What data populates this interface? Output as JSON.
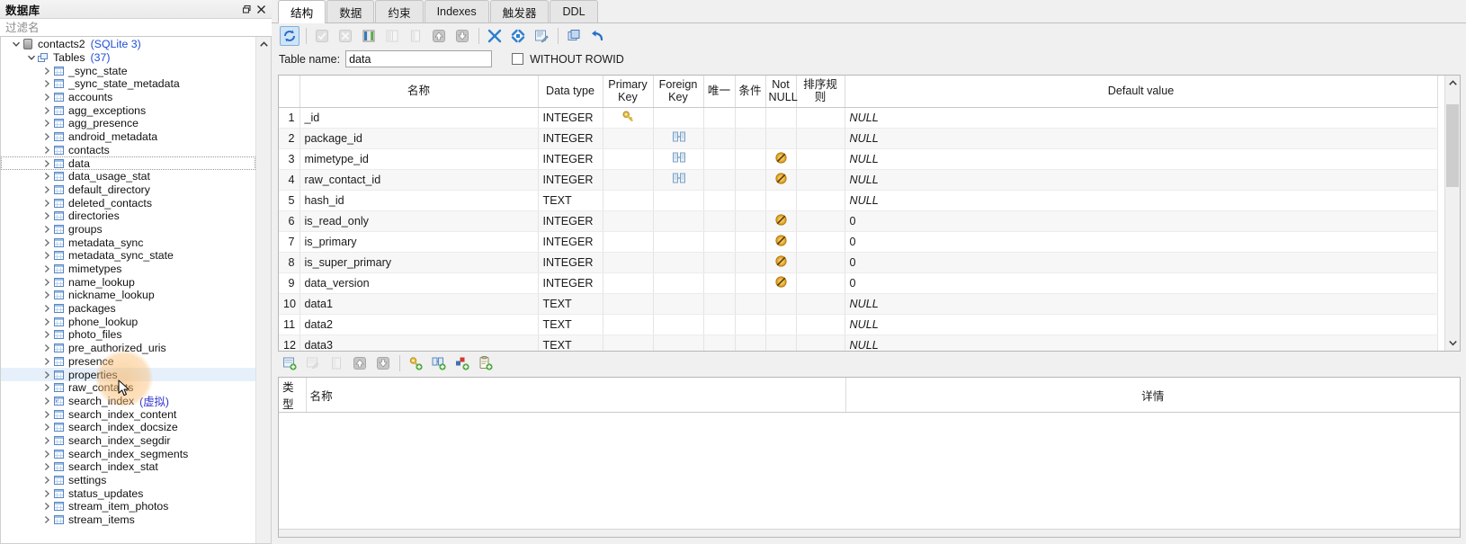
{
  "db_panel": {
    "title": "数据库",
    "float_icon": "restore-icon",
    "close_icon": "close-icon",
    "filter_placeholder": "过滤名",
    "filter_value": "",
    "tree": [
      {
        "depth": 0,
        "twisty": "down",
        "icon": "database-icon",
        "label": "contacts2",
        "sub": "(SQLite 3)"
      },
      {
        "depth": 1,
        "twisty": "down",
        "icon": "tables-folder-icon",
        "label": "Tables",
        "sub": "(37)"
      },
      {
        "depth": 2,
        "twisty": "right",
        "icon": "table-icon",
        "label": "_sync_state",
        "sub": ""
      },
      {
        "depth": 2,
        "twisty": "right",
        "icon": "table-icon",
        "label": "_sync_state_metadata",
        "sub": ""
      },
      {
        "depth": 2,
        "twisty": "right",
        "icon": "table-icon",
        "label": "accounts",
        "sub": ""
      },
      {
        "depth": 2,
        "twisty": "right",
        "icon": "table-icon",
        "label": "agg_exceptions",
        "sub": ""
      },
      {
        "depth": 2,
        "twisty": "right",
        "icon": "table-icon",
        "label": "agg_presence",
        "sub": ""
      },
      {
        "depth": 2,
        "twisty": "right",
        "icon": "table-icon",
        "label": "android_metadata",
        "sub": ""
      },
      {
        "depth": 2,
        "twisty": "right",
        "icon": "table-icon",
        "label": "contacts",
        "sub": ""
      },
      {
        "depth": 2,
        "twisty": "right",
        "icon": "table-icon",
        "label": "data",
        "sub": "",
        "state": "focused"
      },
      {
        "depth": 2,
        "twisty": "right",
        "icon": "table-icon",
        "label": "data_usage_stat",
        "sub": ""
      },
      {
        "depth": 2,
        "twisty": "right",
        "icon": "table-icon",
        "label": "default_directory",
        "sub": ""
      },
      {
        "depth": 2,
        "twisty": "right",
        "icon": "table-icon",
        "label": "deleted_contacts",
        "sub": ""
      },
      {
        "depth": 2,
        "twisty": "right",
        "icon": "table-icon",
        "label": "directories",
        "sub": ""
      },
      {
        "depth": 2,
        "twisty": "right",
        "icon": "table-icon",
        "label": "groups",
        "sub": ""
      },
      {
        "depth": 2,
        "twisty": "right",
        "icon": "table-icon",
        "label": "metadata_sync",
        "sub": ""
      },
      {
        "depth": 2,
        "twisty": "right",
        "icon": "table-icon",
        "label": "metadata_sync_state",
        "sub": ""
      },
      {
        "depth": 2,
        "twisty": "right",
        "icon": "table-icon",
        "label": "mimetypes",
        "sub": ""
      },
      {
        "depth": 2,
        "twisty": "right",
        "icon": "table-icon",
        "label": "name_lookup",
        "sub": ""
      },
      {
        "depth": 2,
        "twisty": "right",
        "icon": "table-icon",
        "label": "nickname_lookup",
        "sub": ""
      },
      {
        "depth": 2,
        "twisty": "right",
        "icon": "table-icon",
        "label": "packages",
        "sub": ""
      },
      {
        "depth": 2,
        "twisty": "right",
        "icon": "table-icon",
        "label": "phone_lookup",
        "sub": ""
      },
      {
        "depth": 2,
        "twisty": "right",
        "icon": "table-icon",
        "label": "photo_files",
        "sub": ""
      },
      {
        "depth": 2,
        "twisty": "right",
        "icon": "table-icon",
        "label": "pre_authorized_uris",
        "sub": ""
      },
      {
        "depth": 2,
        "twisty": "right",
        "icon": "table-icon",
        "label": "presence",
        "sub": ""
      },
      {
        "depth": 2,
        "twisty": "right",
        "icon": "table-icon",
        "label": "properties",
        "sub": "",
        "state": "hover"
      },
      {
        "depth": 2,
        "twisty": "right",
        "icon": "table-icon",
        "label": "raw_contacts",
        "sub": ""
      },
      {
        "depth": 2,
        "twisty": "right",
        "icon": "virtual-table-icon",
        "label": "search_index",
        "sub": "(虚拟)"
      },
      {
        "depth": 2,
        "twisty": "right",
        "icon": "table-icon",
        "label": "search_index_content",
        "sub": ""
      },
      {
        "depth": 2,
        "twisty": "right",
        "icon": "table-icon",
        "label": "search_index_docsize",
        "sub": ""
      },
      {
        "depth": 2,
        "twisty": "right",
        "icon": "table-icon",
        "label": "search_index_segdir",
        "sub": ""
      },
      {
        "depth": 2,
        "twisty": "right",
        "icon": "table-icon",
        "label": "search_index_segments",
        "sub": ""
      },
      {
        "depth": 2,
        "twisty": "right",
        "icon": "table-icon",
        "label": "search_index_stat",
        "sub": ""
      },
      {
        "depth": 2,
        "twisty": "right",
        "icon": "table-icon",
        "label": "settings",
        "sub": ""
      },
      {
        "depth": 2,
        "twisty": "right",
        "icon": "table-icon",
        "label": "status_updates",
        "sub": ""
      },
      {
        "depth": 2,
        "twisty": "right",
        "icon": "table-icon",
        "label": "stream_item_photos",
        "sub": ""
      },
      {
        "depth": 2,
        "twisty": "right",
        "icon": "table-icon",
        "label": "stream_items",
        "sub": ""
      }
    ]
  },
  "tabs": [
    {
      "label": "结构",
      "active": true
    },
    {
      "label": "数据",
      "active": false
    },
    {
      "label": "约束",
      "active": false
    },
    {
      "label": "Indexes",
      "active": false
    },
    {
      "label": "触发器",
      "active": false
    },
    {
      "label": "DDL",
      "active": false
    }
  ],
  "toolbar": [
    {
      "name": "refresh-structure-icon",
      "state": "enabled-active"
    },
    {
      "sep": true
    },
    {
      "name": "commit-check-icon",
      "state": "disabled"
    },
    {
      "name": "rollback-cross-icon",
      "state": "disabled"
    },
    {
      "name": "add-column-icon",
      "state": "enabled"
    },
    {
      "name": "insert-column-icon",
      "state": "disabled"
    },
    {
      "name": "delete-column-icon",
      "state": "disabled"
    },
    {
      "name": "move-column-up-icon",
      "state": "enabled"
    },
    {
      "name": "move-column-down-icon",
      "state": "enabled"
    },
    {
      "sep": true
    },
    {
      "name": "collapse-all-icon",
      "state": "enabled"
    },
    {
      "name": "expand-all-icon",
      "state": "enabled"
    },
    {
      "name": "generate-sql-icon",
      "state": "enabled"
    },
    {
      "sep": true
    },
    {
      "name": "copy-table-icon",
      "state": "enabled"
    },
    {
      "name": "undo-icon",
      "state": "enabled"
    }
  ],
  "table_name_row": {
    "label": "Table name:",
    "value": "data",
    "without_rowid_label": "WITHOUT ROWID",
    "without_rowid_checked": false
  },
  "grid": {
    "headers": [
      "",
      "名称",
      "Data type",
      "Primary Key",
      "Foreign Key",
      "唯一",
      "条件",
      "Not NULL",
      "排序规则",
      "Default value"
    ],
    "rows": [
      {
        "n": "1",
        "name": "_id",
        "type": "INTEGER",
        "pk": "key-icon",
        "fk": "",
        "unique": "",
        "check": "",
        "notnull": "",
        "collate": "",
        "default": "NULL",
        "default_italic": true
      },
      {
        "n": "2",
        "name": "package_id",
        "type": "INTEGER",
        "pk": "",
        "fk": "fk-icon",
        "unique": "",
        "check": "",
        "notnull": "",
        "collate": "",
        "default": "NULL",
        "default_italic": true
      },
      {
        "n": "3",
        "name": "mimetype_id",
        "type": "INTEGER",
        "pk": "",
        "fk": "fk-icon",
        "unique": "",
        "check": "",
        "notnull": "notnull-icon",
        "collate": "",
        "default": "NULL",
        "default_italic": true
      },
      {
        "n": "4",
        "name": "raw_contact_id",
        "type": "INTEGER",
        "pk": "",
        "fk": "fk-icon",
        "unique": "",
        "check": "",
        "notnull": "notnull-icon",
        "collate": "",
        "default": "NULL",
        "default_italic": true
      },
      {
        "n": "5",
        "name": "hash_id",
        "type": "TEXT",
        "pk": "",
        "fk": "",
        "unique": "",
        "check": "",
        "notnull": "",
        "collate": "",
        "default": "NULL",
        "default_italic": true
      },
      {
        "n": "6",
        "name": "is_read_only",
        "type": "INTEGER",
        "pk": "",
        "fk": "",
        "unique": "",
        "check": "",
        "notnull": "notnull-icon",
        "collate": "",
        "default": "0",
        "default_italic": false
      },
      {
        "n": "7",
        "name": "is_primary",
        "type": "INTEGER",
        "pk": "",
        "fk": "",
        "unique": "",
        "check": "",
        "notnull": "notnull-icon",
        "collate": "",
        "default": "0",
        "default_italic": false
      },
      {
        "n": "8",
        "name": "is_super_primary",
        "type": "INTEGER",
        "pk": "",
        "fk": "",
        "unique": "",
        "check": "",
        "notnull": "notnull-icon",
        "collate": "",
        "default": "0",
        "default_italic": false
      },
      {
        "n": "9",
        "name": "data_version",
        "type": "INTEGER",
        "pk": "",
        "fk": "",
        "unique": "",
        "check": "",
        "notnull": "notnull-icon",
        "collate": "",
        "default": "0",
        "default_italic": false
      },
      {
        "n": "10",
        "name": "data1",
        "type": "TEXT",
        "pk": "",
        "fk": "",
        "unique": "",
        "check": "",
        "notnull": "",
        "collate": "",
        "default": "NULL",
        "default_italic": true
      },
      {
        "n": "11",
        "name": "data2",
        "type": "TEXT",
        "pk": "",
        "fk": "",
        "unique": "",
        "check": "",
        "notnull": "",
        "collate": "",
        "default": "NULL",
        "default_italic": true
      },
      {
        "n": "12",
        "name": "data3",
        "type": "TEXT",
        "pk": "",
        "fk": "",
        "unique": "",
        "check": "",
        "notnull": "",
        "collate": "",
        "default": "NULL",
        "default_italic": true
      }
    ]
  },
  "toolbar2": [
    {
      "name": "add-constraint-icon",
      "state": "enabled"
    },
    {
      "name": "edit-constraint-icon",
      "state": "disabled"
    },
    {
      "name": "delete-constraint-icon",
      "state": "disabled"
    },
    {
      "name": "move-constraint-up-icon",
      "state": "enabled"
    },
    {
      "name": "move-constraint-down-icon",
      "state": "enabled"
    },
    {
      "sep": true
    },
    {
      "name": "add-primary-key-icon",
      "state": "enabled"
    },
    {
      "name": "add-foreign-key-icon",
      "state": "enabled"
    },
    {
      "name": "add-unique-icon",
      "state": "enabled"
    },
    {
      "name": "add-check-icon",
      "state": "enabled"
    }
  ],
  "bottom_grid": {
    "headers": [
      "类型",
      "名称",
      "详情"
    ],
    "rows": []
  }
}
